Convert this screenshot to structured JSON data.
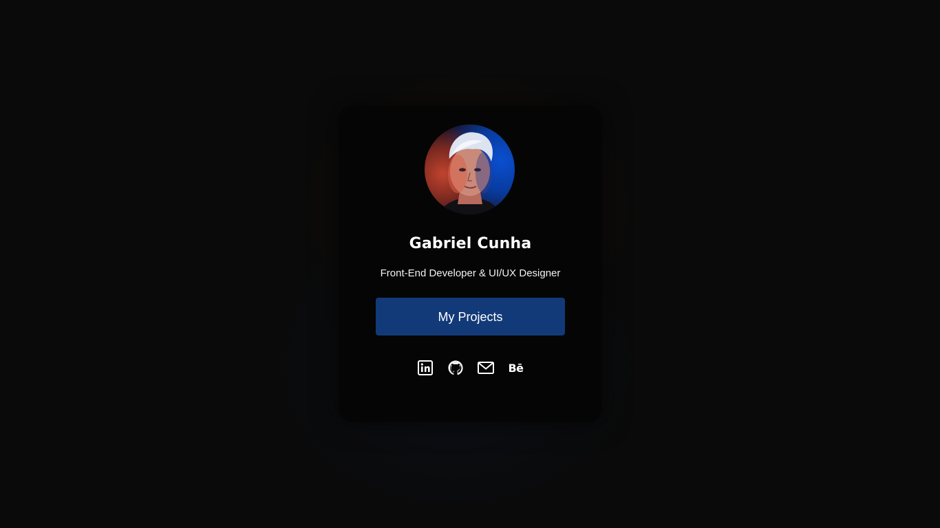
{
  "profile": {
    "name": "Gabriel Cunha",
    "role": "Front-End Developer & UI/UX Designer",
    "avatar_icon": "profile-photo"
  },
  "actions": {
    "projects_label": "My Projects"
  },
  "socials": [
    {
      "icon": "linkedin-icon"
    },
    {
      "icon": "github-icon"
    },
    {
      "icon": "mail-icon"
    },
    {
      "icon": "behance-icon",
      "glyph": "Bē"
    }
  ],
  "colors": {
    "background": "#0a0a0a",
    "card": "#050505",
    "button": "#123a78",
    "text": "#ffffff"
  }
}
